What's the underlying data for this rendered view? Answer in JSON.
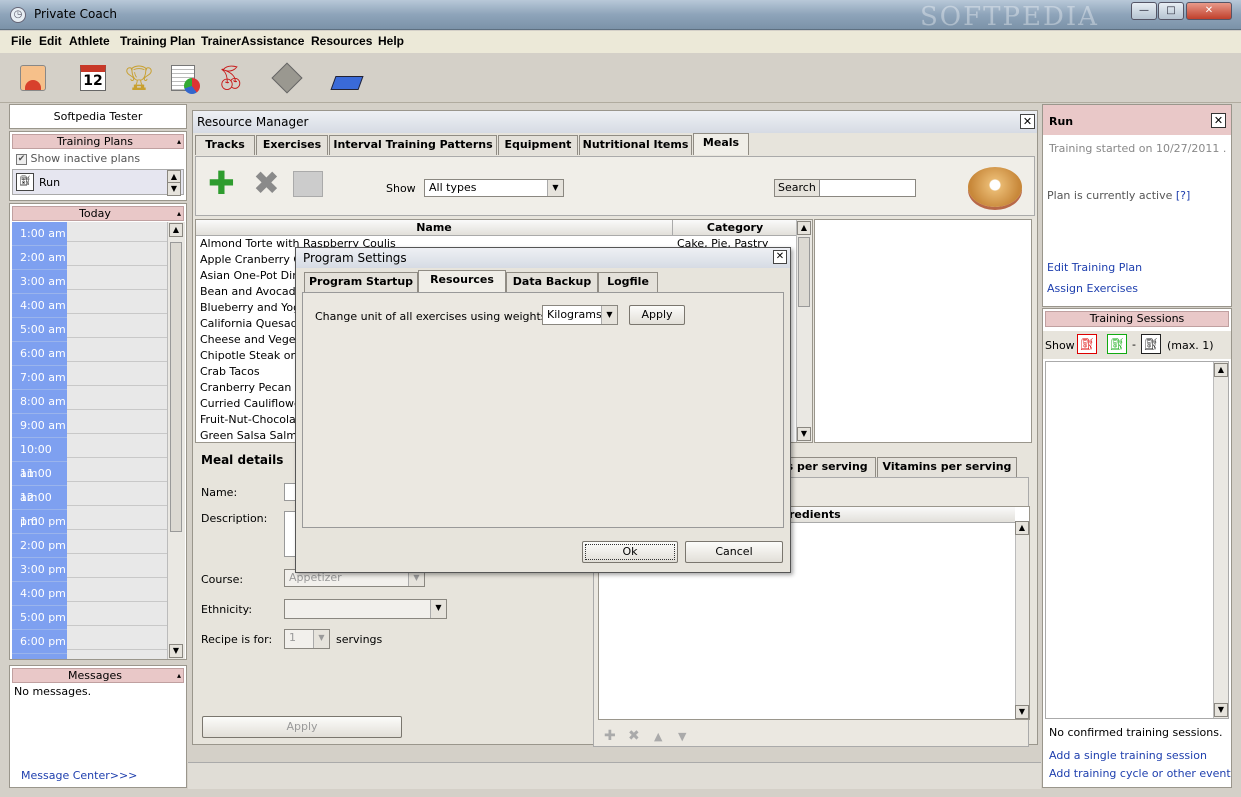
{
  "window": {
    "title": "Private Coach",
    "watermark": "SOFTPEDIA",
    "minimize": "—",
    "maximize": "□",
    "close": "✕"
  },
  "menu": [
    "File",
    "Edit",
    "Athlete",
    "Training Plan",
    "TrainerAssistance",
    "Resources",
    "Help"
  ],
  "toolbar_icons": [
    "athlete-icon",
    "calendar-icon",
    "trophy-icon",
    "report-icon",
    "cherries-icon",
    "equipment-icon",
    "treadmill-icon"
  ],
  "calendar_icon_day": "12",
  "left": {
    "user": "Softpedia Tester",
    "plans_header": "Training Plans",
    "show_inactive": "Show inactive plans",
    "plan": "Run",
    "today_header": "Today",
    "times": [
      "1:00 am",
      "2:00 am",
      "3:00 am",
      "4:00 am",
      "5:00 am",
      "6:00 am",
      "7:00 am",
      "8:00 am",
      "9:00 am",
      "10:00 am",
      "11:00 am",
      "12:00 pm",
      "1:00 pm",
      "2:00 pm",
      "3:00 pm",
      "4:00 pm",
      "5:00 pm",
      "6:00 pm"
    ],
    "messages_header": "Messages",
    "no_messages": "No messages.",
    "message_center": "Message Center>>>"
  },
  "resource_manager": {
    "title": "Resource Manager",
    "tabs": [
      "Tracks",
      "Exercises",
      "Interval Training Patterns",
      "Equipment",
      "Nutritional Items",
      "Meals"
    ],
    "show_label": "Show",
    "show_value": "All types",
    "search_label": "Search",
    "search_value": "",
    "columns": {
      "name": "Name",
      "category": "Category"
    },
    "first_category": "Cake, Pie, Pastry",
    "meals": [
      "Almond Torte with Raspberry Coulis",
      "Apple Cranberry Cri",
      "Asian One-Pot Dinne",
      "Bean and Avocado S",
      "Blueberry and Yogur",
      "California Quesadilla",
      "Cheese and Vegetab",
      "Chipotle Steak on Sa",
      "Crab Tacos",
      "Cranberry Pecan Sa",
      "Curried Cauliflower S",
      "Fruit-Nut-Chocolate",
      "Green Salsa Salmon"
    ],
    "meal_details": "Meal details",
    "name_label": "Name:",
    "description_label": "Description:",
    "course_label": "Course:",
    "course_value": "Appetizer",
    "ethnicity_label": "Ethnicity:",
    "recipe_label": "Recipe is for:",
    "recipe_value": "1",
    "servings": "servings",
    "apply": "Apply",
    "sub_tabs": [
      "ts per serving",
      "Vitamins per serving"
    ],
    "ingredients_header": "redients"
  },
  "dialog": {
    "title": "Program Settings",
    "tabs": [
      "Program Startup",
      "Resources",
      "Data Backup",
      "Logfile"
    ],
    "unit_label": "Change unit of all exercises using weights to",
    "unit_value": "Kilograms",
    "apply": "Apply",
    "ok": "Ok",
    "cancel": "Cancel"
  },
  "right": {
    "title": "Run",
    "started": "Training started on 10/27/2011 .",
    "active": "Plan is currently active",
    "help": "[?]",
    "edit_plan": "Edit Training Plan",
    "assign": "Assign Exercises",
    "sessions_header": "Training Sessions",
    "show": "Show",
    "dash": "-",
    "max": "(max. 1)",
    "no_sessions": "No confirmed training sessions.",
    "add_single": "Add a single training session",
    "add_cycle": "Add training cycle or other event"
  }
}
